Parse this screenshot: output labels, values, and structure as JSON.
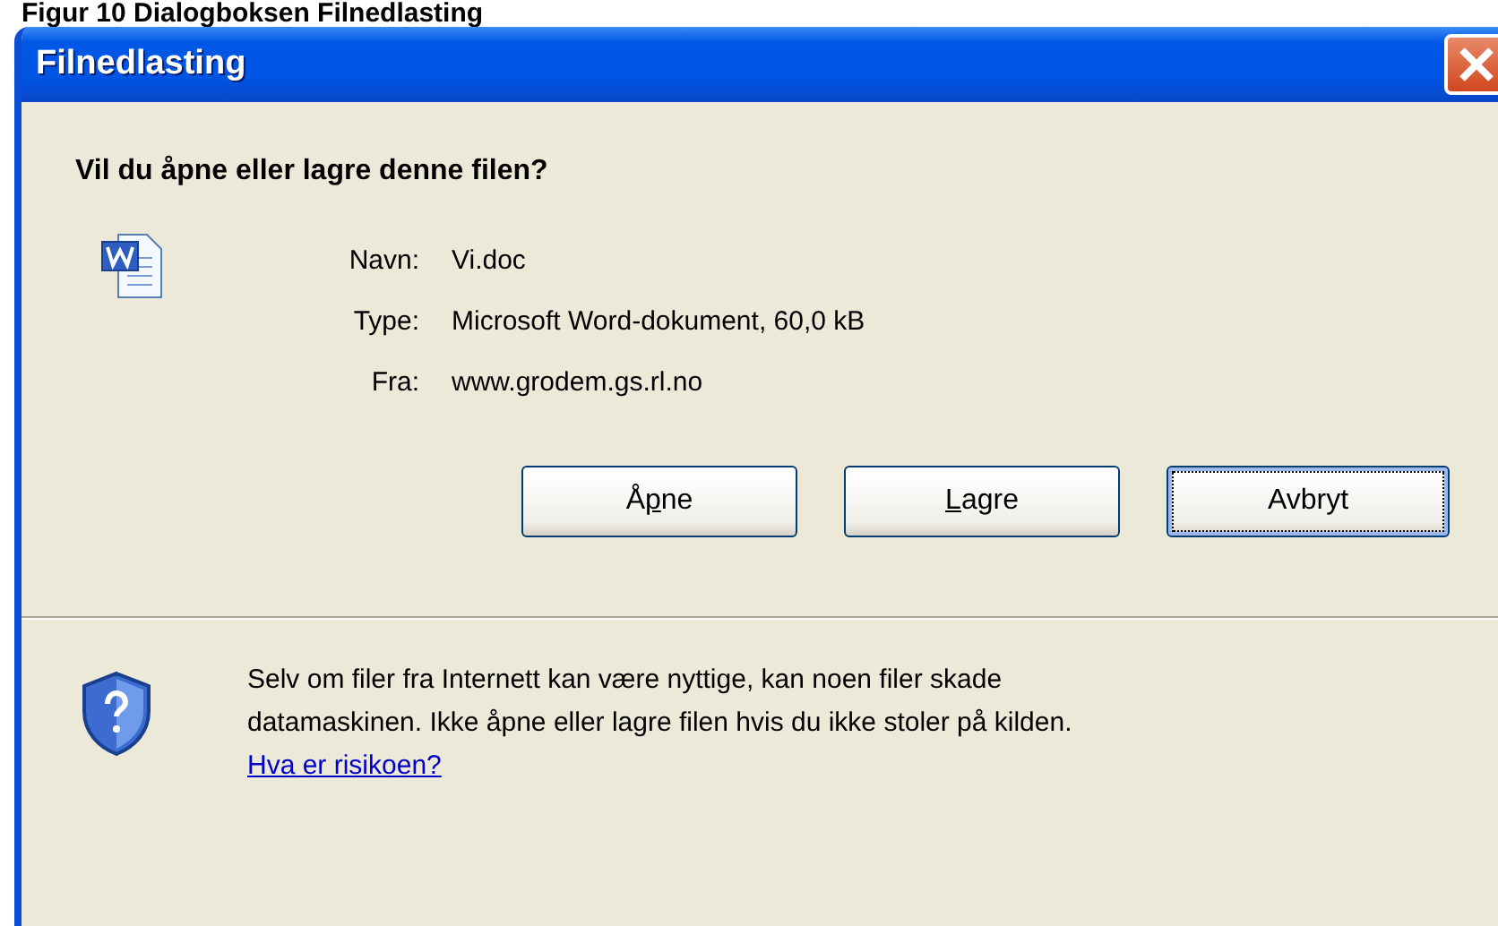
{
  "caption": "Figur 10 Dialogboksen Filnedlasting",
  "window": {
    "title": "Filnedlasting"
  },
  "question": "Vil du åpne eller lagre denne filen?",
  "file_info": [
    {
      "label": "Navn:",
      "value": "Vi.doc"
    },
    {
      "label": "Type:",
      "value": "Microsoft Word-dokument, 60,0 kB"
    },
    {
      "label": "Fra:",
      "value": "www.grodem.gs.rl.no"
    }
  ],
  "buttons": [
    {
      "before": "Å",
      "key": "p",
      "after": "ne",
      "focused": false
    },
    {
      "key": "L",
      "after": "agre",
      "focused": false
    },
    {
      "before": "Avbryt",
      "focused": true
    }
  ],
  "warning": {
    "lines": [
      "Selv om filer fra Internett kan være nyttige, kan noen filer skade",
      "datamaskinen. Ikke åpne eller lagre filen hvis du ikke stoler på kilden."
    ],
    "link": "Hva er risikoen?"
  }
}
